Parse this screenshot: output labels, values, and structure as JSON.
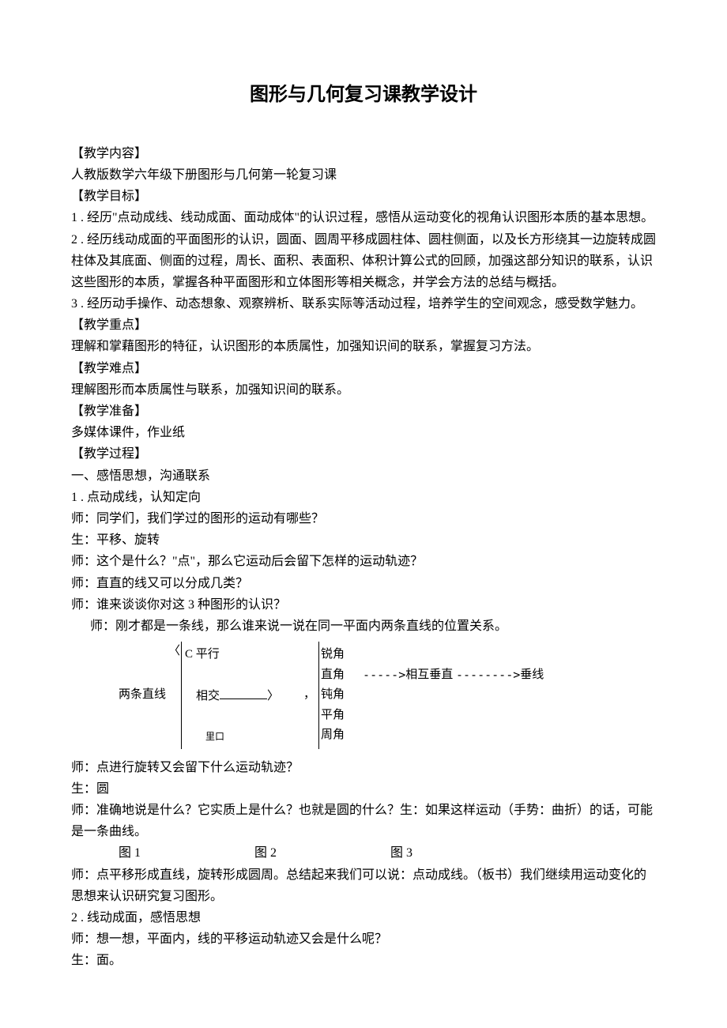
{
  "title": "图形与几何复习课教学设计",
  "sections": {
    "content_label": "【教学内容】",
    "content_text": "人教版数学六年级下册图形与几何第一轮复习课",
    "goal_label": "【教学目标】",
    "goal_1": "1 . 经历\"点动成线、线动成面、面动成体\"的认识过程，感悟从运动变化的视角认识图形本质的基本思想。",
    "goal_2": "2 . 经历线动成面的平面图形的认识，圆面、圆周平移成圆柱体、圆柱侧面，以及长方形绕其一边旋转成圆柱体及其底面、侧面的过程，周长、面积、表面积、体积计算公式的回顾，加强这部分知识的联系，认识这些图形的本质，掌握各种平面图形和立体图形等相关概念，并学会方法的总结与概括。",
    "goal_3": "3 . 经历动手操作、动态想象、观察辨析、联系实际等活动过程，培养学生的空间观念，感受数学魅力。",
    "focus_label": "【教学重点】",
    "focus_text": "理解和掌藉图形的特征，认识图形的本质属性，加强知识间的联系，掌握复习方法。",
    "difficulty_label": "【教学难点】",
    "difficulty_text": "理解图形而本质属性与联系，加强知识间的联系。",
    "prep_label": "【教学准备】",
    "prep_text": "多媒体课件，作业纸",
    "process_label": "【教学过程】",
    "process_h1": "一、感悟思想，沟通联系",
    "process_1_1": "1 . 点动成线，认知定向",
    "line_t1": "师：同学们，我们学过的图形的运动有哪些？",
    "line_s1": "生：平移、旋转",
    "line_t2": "师：这个是什么？\"点\"，那么它运动后会留下怎样的运动轨迹？",
    "line_t3": "师：直直的线又可以分成几类？",
    "line_t4": "师：谁来谈谈你对这 3 种图形的认识？",
    "line_t5": "师：刚才都是一条线，那么谁来说一说在同一平面内两条直线的位置关系。",
    "brace": {
      "two_lines": "两条直线",
      "parallel": "C 平行",
      "intersect": "相交",
      "overlap": "里口",
      "acute": "锐角",
      "right": "直角",
      "perpendicular": "相互垂直",
      "vertical_line": "垂线",
      "obtuse": "钝角",
      "straight_angle": "平角",
      "reflex": "周角",
      "angle_sep": "〉",
      "comma": "，",
      "arrow1": "----->",
      "arrow2": "-------->"
    },
    "line_t6": "师：点进行旋转又会留下什么运动轨迹？",
    "line_s2": "生：圆",
    "line_t7": "师：准确地说是什么？它实质上是什么？也就是圆的什么？生：如果这样运动（手势：曲折）的话，可能是一条曲线。",
    "fig1": "图 1",
    "fig2": "图 2",
    "fig3": "图 3",
    "line_t8": "师：点平移形成直线，旋转形成圆周。总结起来我们可以说：点动成线。（板书）我们继续用运动变化的思想来认识研究复习图形。",
    "process_1_2": "2 . 线动成面，感悟思想",
    "line_t9": "师：想一想，平面内，线的平移运动轨迹又会是什么呢？",
    "line_s3": "生：面。"
  }
}
